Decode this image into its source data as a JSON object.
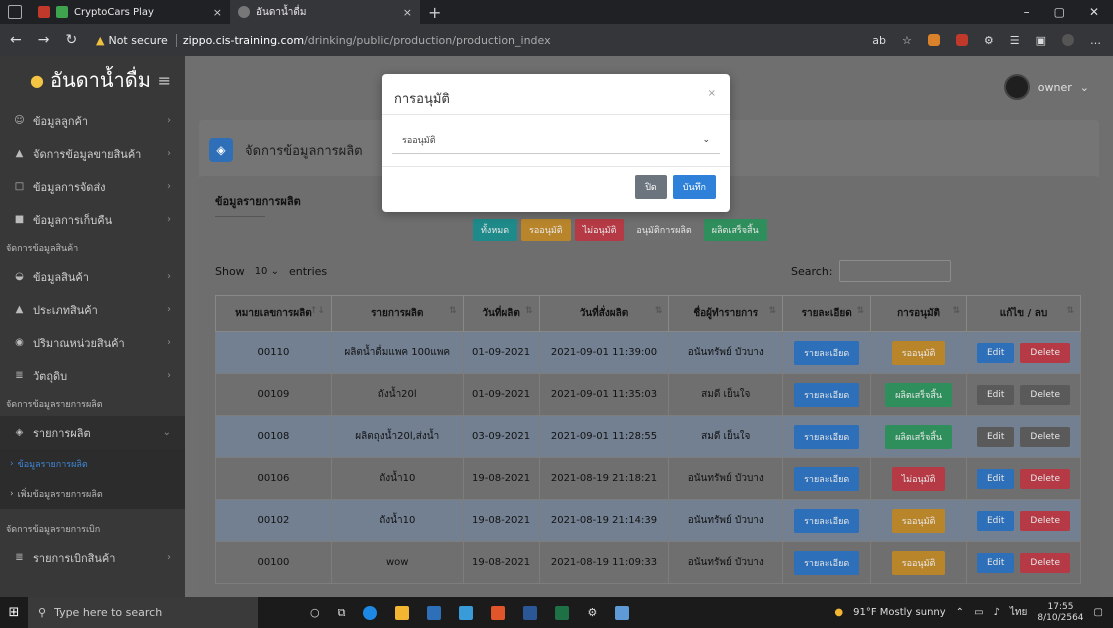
{
  "browser": {
    "tabs": [
      {
        "label": "CryptoCars Play"
      },
      {
        "label": "อันดาน้ำดื่ม"
      }
    ],
    "security": "Not secure",
    "url_host": "zippo.cis-training.com",
    "url_path": "/drinking/public/production/production_index"
  },
  "sidebar": {
    "brand": "อันดาน้ำดื่ม",
    "items_top": [
      {
        "label": "ข้อมูลลูกค้า",
        "icon": "users-icon"
      },
      {
        "label": "จัดการข้อมูลขายสินค้า",
        "icon": "building-icon"
      },
      {
        "label": "ข้อมูลการจัดส่ง",
        "icon": "box-icon"
      },
      {
        "label": "ข้อมูลการเก็บคืน",
        "icon": "truck-icon"
      }
    ],
    "section_products": "จัดการข้อมูลสินค้า",
    "items_products": [
      {
        "label": "ข้อมูลสินค้า",
        "icon": "cart-icon"
      },
      {
        "label": "ประเภทสินค้า",
        "icon": "building-icon"
      },
      {
        "label": "ปริมาณหน่วยสินค้า",
        "icon": "gauge-icon"
      },
      {
        "label": "วัตถุดิบ",
        "icon": "list-icon"
      }
    ],
    "section_production": "จัดการข้อมูลรายการผลิต",
    "production_item": "รายการผลิต",
    "production_subitems": [
      "ข้อมูลรายการผลิต",
      "เพิ่มข้อมูลรายการผลิต"
    ],
    "section_withdraw": "จัดการข้อมูลรายการเบิก",
    "withdraw_item": "รายการเบิกสินค้า"
  },
  "topnav": {
    "user": "owner"
  },
  "page": {
    "title": "จัดการข้อมูลการผลิต"
  },
  "card": {
    "title": "ข้อมูลรายการผลิต",
    "filters": [
      {
        "label": "ทั้งหมด",
        "color": "#1f8a8a"
      },
      {
        "label": "รออนุมัติ",
        "color": "#b8852b"
      },
      {
        "label": "ไม่อนุมัติ",
        "color": "#b53a45"
      },
      {
        "label": "อนุมัติการผลิต",
        "color": "#6f6f6f"
      },
      {
        "label": "ผลิตเสร็จสิ้น",
        "color": "#2f8f5c"
      }
    ],
    "show_label": "Show",
    "show_value": "10",
    "entries_label": "entries",
    "search_label": "Search:"
  },
  "table": {
    "headers": [
      "หมายเลขการผลิต",
      "รายการผลิต",
      "วันที่ผลิต",
      "วันที่สั่งผลิต",
      "ชื่อผู้ทำรายการ",
      "รายละเอียด",
      "การอนุมัติ",
      "แก้ไข / ลบ"
    ],
    "detail_label": "รายละเอียด",
    "edit_label": "Edit",
    "delete_label": "Delete",
    "rows": [
      {
        "id": "00110",
        "item": "ผลิตน้ำดื่มแพค 100แพค",
        "prod_date": "01-09-2021",
        "order_date": "2021-09-01 11:39:00",
        "by": "อนันทรัพย์ บัวบาง",
        "status": "รออนุมัติ",
        "status_class": "orange",
        "actions_active": true
      },
      {
        "id": "00109",
        "item": "ถังน้ำ20l",
        "prod_date": "01-09-2021",
        "order_date": "2021-09-01 11:35:03",
        "by": "สมดี เย็นใจ",
        "status": "ผลิตเสร็จสิ้น",
        "status_class": "green",
        "actions_active": false
      },
      {
        "id": "00108",
        "item": "ผลิตถุงน้ำ20l,ส่งน้ำ",
        "prod_date": "03-09-2021",
        "order_date": "2021-09-01 11:28:55",
        "by": "สมดี เย็นใจ",
        "status": "ผลิตเสร็จสิ้น",
        "status_class": "green",
        "actions_active": false
      },
      {
        "id": "00106",
        "item": "ถังน้ำ10",
        "prod_date": "19-08-2021",
        "order_date": "2021-08-19 21:18:21",
        "by": "อนันทรัพย์ บัวบาง",
        "status": "ไม่อนุมัติ",
        "status_class": "red",
        "actions_active": true
      },
      {
        "id": "00102",
        "item": "ถังน้ำ10",
        "prod_date": "19-08-2021",
        "order_date": "2021-08-19 21:14:39",
        "by": "อนันทรัพย์ บัวบาง",
        "status": "รออนุมัติ",
        "status_class": "orange",
        "actions_active": true
      },
      {
        "id": "00100",
        "item": "wow",
        "prod_date": "19-08-2021",
        "order_date": "2021-08-19 11:09:33",
        "by": "อนันทรัพย์ บัวบาง",
        "status": "รออนุมัติ",
        "status_class": "orange",
        "actions_active": true
      }
    ]
  },
  "modal": {
    "title": "การอนุมัติ",
    "close_x": "×",
    "select_value": "รออนุมัติ",
    "close_btn": "ปิด",
    "save_btn": "บันทึก"
  },
  "taskbar": {
    "search_placeholder": "Type here to search",
    "weather": "91°F Mostly sunny",
    "lang": "ไทย",
    "time": "17:55",
    "date": "8/10/2564"
  }
}
